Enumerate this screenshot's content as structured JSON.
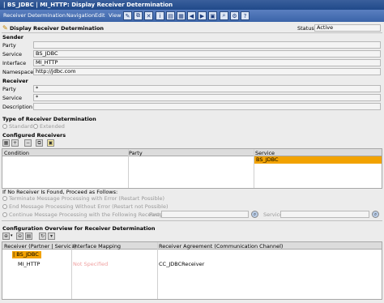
{
  "window": {
    "title": "| BS_JDBC | MI_HTTP: Display Receiver Determination"
  },
  "menu": [
    "Receiver Determination",
    "Navigation",
    "Edit",
    "View"
  ],
  "header": {
    "title": "Display Receiver Determination",
    "status_label": "Status",
    "status_value": "Active"
  },
  "sender": {
    "section": "Sender",
    "party_label": "Party",
    "party_value": "",
    "service_label": "Service",
    "service_value": "BS_JDBC",
    "interface_label": "Interface",
    "interface_value": "MI_HTTP",
    "namespace_label": "Namespace",
    "namespace_value": "http://jdbc.com"
  },
  "receiver": {
    "section": "Receiver",
    "party_label": "Party",
    "party_value": "*",
    "service_label": "Service",
    "service_value": "*",
    "description_label": "Description",
    "description_value": ""
  },
  "type": {
    "section": "Type of Receiver Determination",
    "standard": "Standard",
    "extended": "Extended"
  },
  "configured": {
    "section": "Configured Receivers",
    "columns": [
      "Condition",
      "Party",
      "Service"
    ],
    "rows": [
      {
        "condition": "",
        "party": "",
        "service": "BS_JDBC"
      }
    ]
  },
  "noreceiver": {
    "title": "If No Receiver Is Found, Proceed as Follows:",
    "opt1": "Terminate Message Processing with Error (Restart Possible)",
    "opt2": "End Message Processing Without Error (Restart not Possible)",
    "opt3": "Continue Message Processing with the Following Receiver:",
    "party_label": "Party",
    "service_label": "Service"
  },
  "overview": {
    "title": "Configuration Overview for Receiver Determination",
    "columns": [
      "Receiver (Partner | Service)",
      "Interface Mapping",
      "Receiver Agreement (Communication Channel)"
    ],
    "service_row": "| BS_JDBC",
    "interface_row": {
      "interface": "MI_HTTP",
      "mapping": "Not Specified",
      "agreement": "CC_JDBCReceiver"
    }
  }
}
